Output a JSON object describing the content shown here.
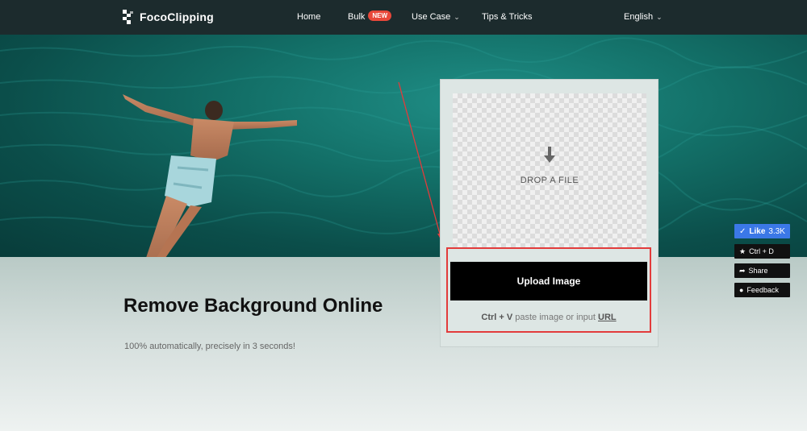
{
  "nav": {
    "brand": "FocoClipping",
    "links": [
      {
        "label": "Home"
      },
      {
        "label": "Bulk",
        "badge": "NEW"
      },
      {
        "label": "Use Case"
      },
      {
        "label": "Tips & Tricks"
      }
    ],
    "language": "English",
    "icons": {
      "dropdown": "chevron-down-icon",
      "logo": "fococlipping-logo-icon"
    }
  },
  "hero": {
    "headline": "Remove Background Online",
    "subline": "100% automatically, precisely in 3 seconds!"
  },
  "upload": {
    "drop_label": "DROP A FILE",
    "button_label": "Upload Image",
    "paste_shortcut": "Ctrl + V",
    "paste_text": "paste image or input",
    "url_link": "URL",
    "icons": {
      "drop": "arrow-down-icon"
    }
  },
  "side": {
    "like_label": "Like",
    "like_count": "3.3K",
    "bookmark_label": "Ctrl + D",
    "share_label": "Share",
    "feedback_label": "Feedback"
  },
  "colors": {
    "nav_bg": "#1c2b2d",
    "badge": "#e8483a",
    "like_button": "#3b78e7",
    "highlight": "#e23b3b",
    "water": "#137068"
  }
}
